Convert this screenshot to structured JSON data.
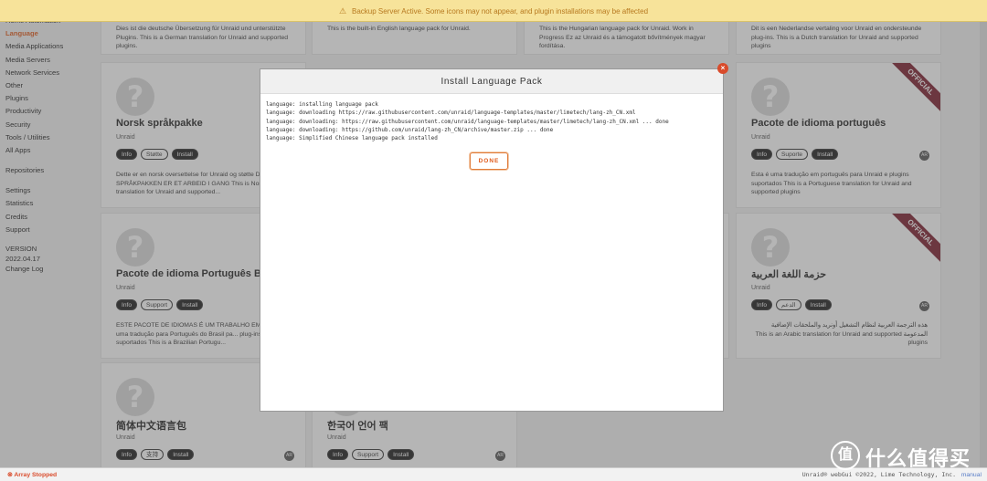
{
  "banner": {
    "text": "Backup Server Active. Some icons may not appear, and plugin installations may be affected"
  },
  "sidebar": {
    "items": [
      {
        "label": "Home Automation"
      },
      {
        "label": "Language",
        "active": true
      },
      {
        "label": "Media Applications"
      },
      {
        "label": "Media Servers"
      },
      {
        "label": "Network Services"
      },
      {
        "label": "Other"
      },
      {
        "label": "Plugins"
      },
      {
        "label": "Productivity"
      },
      {
        "label": "Security"
      },
      {
        "label": "Tools / Utilities"
      },
      {
        "label": "All Apps"
      }
    ],
    "repositories": "Repositories",
    "items2": [
      {
        "label": "Settings"
      },
      {
        "label": "Statistics"
      },
      {
        "label": "Credits"
      },
      {
        "label": "Support"
      }
    ],
    "version_label": "VERSION",
    "version_value": "2022.04.17",
    "change_log": "Change Log"
  },
  "cards": {
    "top": [
      {
        "desc": "Dies ist die deutsche Übersetzung für Unraid und unterstützte Plugins. This is a German translation for Unraid and supported plugins."
      },
      {
        "desc": "This is the built-in English language pack for Unraid."
      },
      {
        "desc": "This is the Hungarian language pack for Unraid. Work in Progress Ez az Unraid és a támogatott bővítmények magyar fordítása."
      },
      {
        "desc": "Dit is een Nederlandse vertaling voor Unraid en ondersteunde plug-ins. This is a Dutch translation for Unraid and supported plugins"
      }
    ],
    "norsk": {
      "title": "Norsk språkpakke",
      "author": "Unraid",
      "buttons": [
        "Info",
        "Støtte",
        "Install"
      ],
      "desc": "Dette er en norsk oversettelse for Unraid og støtte DENNE SPRÅKPAKKEN ER ET ARBEID I GANG This is Norwegian translation for Unraid and supported..."
    },
    "portugues": {
      "title": "Pacote de idioma português",
      "author": "Unraid",
      "buttons": [
        "Info",
        "Suporte",
        "Install"
      ],
      "desc": "Esta é uma tradução em português para Unraid e plugins suportados This is a Portuguese translation for Unraid and supported plugins",
      "ribbon": "OFFICIAL"
    },
    "brasil": {
      "title": "Pacote de idioma Português Brasil",
      "author": "Unraid",
      "buttons": [
        "Info",
        "Support",
        "Install"
      ],
      "desc": "ESTE PACOTE DE IDIOMAS É UM TRABALHO EM A... Esta é uma tradução para Português do Brasil pa... plug-ins suportados This is a Brazilian Portugu..."
    },
    "arabic": {
      "title": "حزمة اللغة العربية",
      "author": "Unraid",
      "buttons": [
        "Info",
        "الدعم",
        "Install"
      ],
      "desc": "هذه الترجمة العربية لنظام التشغيل أونريد والملحقات الإضافية المدعومة This is an Arabic translation for Unraid and supported plugins",
      "ribbon": "OFFICIAL"
    },
    "chinese": {
      "title": "简体中文语言包",
      "author": "Unraid",
      "buttons": [
        "Info",
        "支持",
        "Install"
      ]
    },
    "korean": {
      "title": "한국어 언어 팩",
      "author": "Unraid",
      "buttons": [
        "Info",
        "Support",
        "Install"
      ]
    },
    "sr_badge": "AR"
  },
  "dialog": {
    "title": "Install Language Pack",
    "log": [
      "language: installing language pack",
      "language: downloading https://raw.githubusercontent.com/unraid/language-templates/master/limetech/lang-zh_CN.xml",
      "language: downloading: https://raw.githubusercontent.com/unraid/language-templates/master/limetech/lang-zh_CN.xml ... done",
      "language: downloading: https://github.com/unraid/lang-zh_CN/archive/master.zip ... done",
      "language: Simplified Chinese language pack installed"
    ],
    "done_label": "DONE",
    "close_glyph": "×"
  },
  "footer": {
    "status": "Array Stopped",
    "copyright": "Unraid® webGui ©2022, Lime Technology, Inc.",
    "manual": "manual"
  },
  "watermark": {
    "text": "什么值得买",
    "logo": "值"
  }
}
